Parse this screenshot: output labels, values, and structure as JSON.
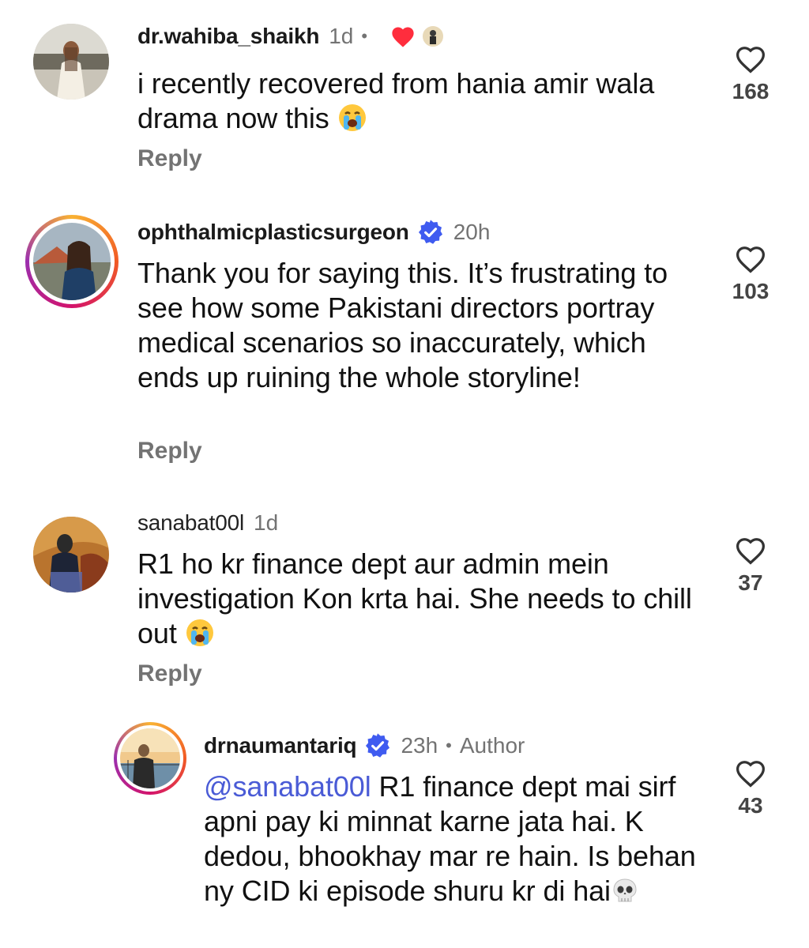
{
  "comments": [
    {
      "username": "dr.wahiba_shaikh",
      "time": "1d",
      "text": "i recently recovered from hania amir wala drama now this",
      "reply_label": "Reply",
      "like_count": "168"
    },
    {
      "username": "ophthalmicplasticsurgeon",
      "time": "20h",
      "text": "Thank you for saying this. It’s frustrating to see how some Pakistani directors portray medical scenarios so inaccurately, which ends up ruining the whole storyline!",
      "reply_label": "Reply",
      "like_count": "103"
    },
    {
      "username": "sanabat00l",
      "time": "1d",
      "text": "R1 ho kr finance dept aur admin mein investigation Kon krta hai. She needs to chill out",
      "reply_label": "Reply",
      "like_count": "37"
    },
    {
      "username": "drnaumantariq",
      "time": "23h",
      "author_label": "Author",
      "mention": "@sanabat00l",
      "text": " R1 finance dept mai sirf apni pay ki minnat karne jata hai. K dedou, bhookhay mar re hain. Is behan ny CID ki episode shuru kr di hai",
      "like_count": "43"
    }
  ],
  "colors": {
    "verified": "#3f5bf0",
    "heart_liked": "#ff2d3d",
    "mention": "#4a5bd6",
    "muted": "#737373"
  },
  "icons": [
    "heart-outline-icon",
    "heart-filled-icon",
    "verified-badge-icon",
    "loudly-crying-face-emoji",
    "skull-emoji"
  ]
}
